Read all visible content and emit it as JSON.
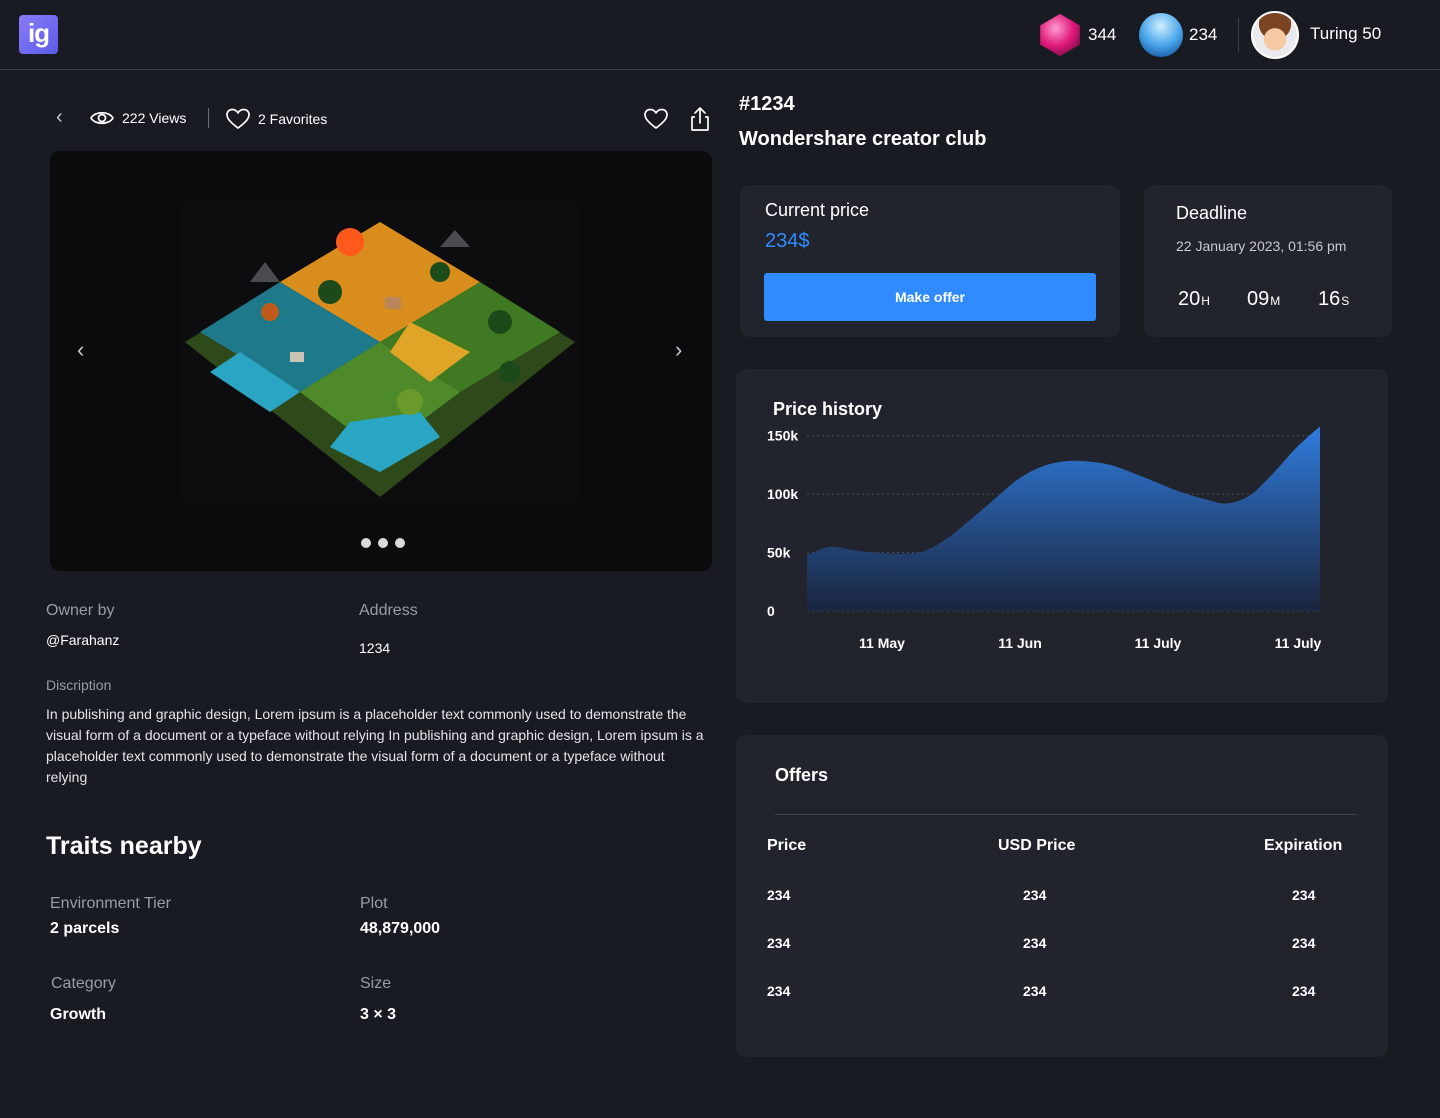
{
  "header": {
    "logo_text": "ig",
    "gems_count": "344",
    "igloo_count": "234",
    "username": "Turing 50"
  },
  "stats": {
    "views": "222 Views",
    "favorites": "2 Favorites"
  },
  "info": {
    "owner_label": "Owner by",
    "owner_value": "@Farahanz",
    "address_label": "Address",
    "address_value": "1234",
    "description_label": "Discription",
    "description": "In publishing and graphic design, Lorem ipsum is a placeholder text commonly used to demonstrate the visual form of a document or a typeface without relying In publishing and graphic design, Lorem ipsum is a placeholder text commonly used to demonstrate the visual form of a document or a typeface without relying"
  },
  "traits": {
    "title": "Traits nearby",
    "items": [
      {
        "label": "Environment Tier",
        "value": "2 parcels"
      },
      {
        "label": "Plot",
        "value": "48,879,000"
      },
      {
        "label": "Category",
        "value": "Growth"
      },
      {
        "label": "Size",
        "value": "3 × 3"
      }
    ]
  },
  "nft": {
    "id": "#1234",
    "name": "Wondershare creator club"
  },
  "price_card": {
    "title": "Current price",
    "price": "234$",
    "button": "Make offer"
  },
  "deadline": {
    "title": "Deadline",
    "date": "22 January 2023, 01:56 pm",
    "hours": "20",
    "hours_unit": "H",
    "minutes": "09",
    "minutes_unit": "M",
    "seconds": "16",
    "seconds_unit": "S"
  },
  "chart_data": {
    "type": "area",
    "title": "Price history",
    "y_ticks": [
      "150k",
      "100k",
      "50k",
      "0"
    ],
    "y_tick_values": [
      150000,
      100000,
      50000,
      0
    ],
    "ylim": [
      0,
      160000
    ],
    "x_tick_labels": [
      "11 May",
      "11 Jun",
      "11 July",
      "11 July"
    ],
    "series": [
      {
        "values": [
          48000,
          55000,
          52000,
          50000,
          49000,
          51000,
          62000,
          78000,
          95000,
          112000,
          123000,
          128000,
          128000,
          125000,
          118000,
          110000,
          102000,
          96000,
          92000,
          99000,
          118000,
          140000,
          158000
        ]
      }
    ],
    "color": "#2f7de0",
    "grid": true
  },
  "offers": {
    "title": "Offers",
    "columns": [
      "Price",
      "USD Price",
      "Expiration"
    ],
    "rows": [
      [
        "234",
        "234",
        "234"
      ],
      [
        "234",
        "234",
        "234"
      ],
      [
        "234",
        "234",
        "234"
      ]
    ]
  }
}
